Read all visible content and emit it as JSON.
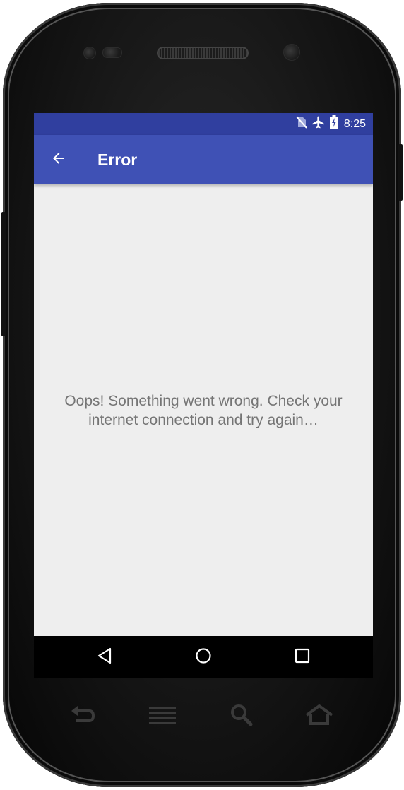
{
  "status_bar": {
    "time": "8:25",
    "icons": [
      "no-sim-icon",
      "airplane-mode-icon",
      "battery-charging-icon"
    ],
    "background_color": "#303f9f"
  },
  "app_bar": {
    "title": "Error",
    "back_icon": "arrow-back-icon",
    "background_color": "#3f51b5"
  },
  "content": {
    "message": "Oops! Something went wrong. Check your internet connection and try again…",
    "background_color": "#eeeeee",
    "text_color": "#757575"
  },
  "nav_bar": {
    "buttons": [
      "back-triangle-icon",
      "home-circle-icon",
      "recents-square-icon"
    ]
  },
  "device": {
    "hardware_buttons": [
      "hw-back-icon",
      "hw-menu-icon",
      "hw-search-icon",
      "hw-home-icon"
    ]
  }
}
